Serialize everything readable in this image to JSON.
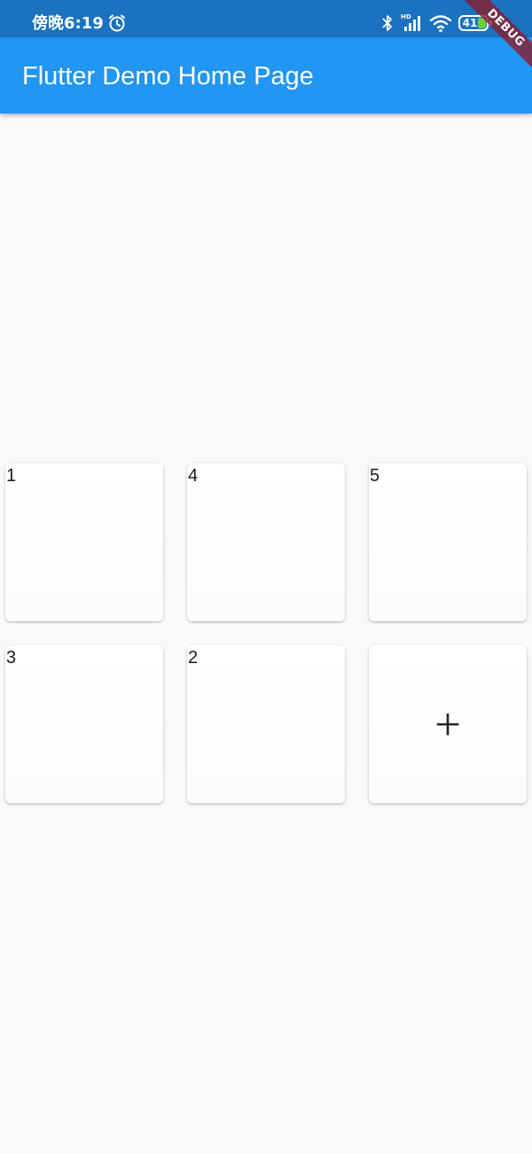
{
  "status_bar": {
    "time": "傍晚6:19",
    "battery_level": "41",
    "icons": [
      "alarm-icon",
      "bluetooth-icon",
      "hd-signal-icon",
      "wifi-icon",
      "battery-icon"
    ]
  },
  "app_bar": {
    "title": "Flutter Demo Home Page",
    "color": "#2196f3"
  },
  "debug_banner": {
    "label": "DEBUG"
  },
  "grid": {
    "cards": [
      {
        "label": "1"
      },
      {
        "label": "4"
      },
      {
        "label": "5"
      },
      {
        "label": "3"
      },
      {
        "label": "2"
      }
    ],
    "add_card_icon": "add-icon"
  },
  "colors": {
    "status_bar": "#1a72c0",
    "background": "#f9f8fa",
    "battery_fill": "#6bd13b",
    "debug_banner": "#8c1928"
  }
}
